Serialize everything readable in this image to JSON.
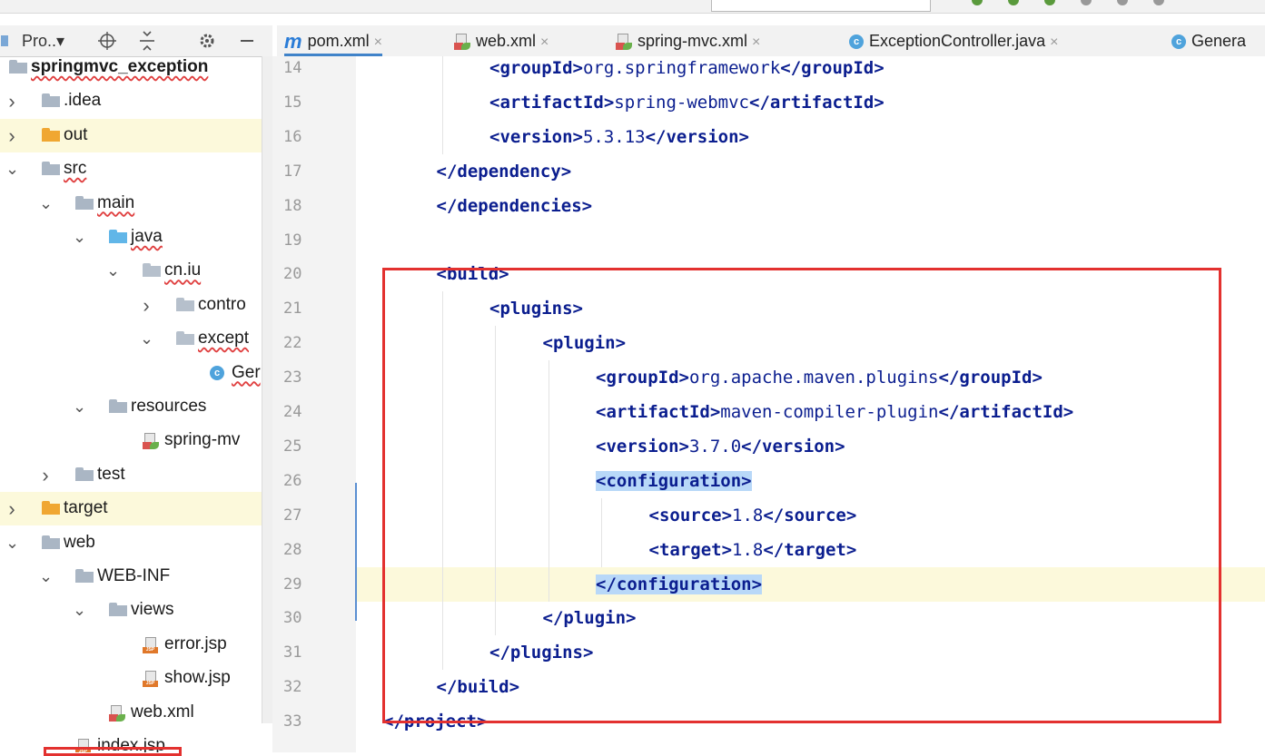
{
  "project_header": {
    "label": "Pro..▾",
    "icons": [
      "target-icon",
      "collapse-icon",
      "gear-icon",
      "minimize-icon"
    ]
  },
  "tabs": [
    {
      "label": "pom.xml",
      "icon": "maven-icon",
      "close": "×",
      "active": true
    },
    {
      "label": "web.xml",
      "icon": "xml-file-icon",
      "close": "×"
    },
    {
      "label": "spring-mvc.xml",
      "icon": "xml-file-icon",
      "close": "×"
    },
    {
      "label": "ExceptionController.java",
      "icon": "class-icon",
      "close": "×"
    },
    {
      "label": "Genera",
      "icon": "class-icon",
      "close": ""
    }
  ],
  "tree": [
    {
      "label": "springmvc_exception",
      "icon": "folder",
      "depth": 0,
      "arrow": "",
      "bold": true,
      "wavy": true
    },
    {
      "label": ".idea",
      "icon": "folder-grey",
      "depth": 0,
      "arrow": ">"
    },
    {
      "label": "out",
      "icon": "folder-orange",
      "depth": 0,
      "arrow": ">",
      "highlight": true
    },
    {
      "label": "src",
      "icon": "folder-grey",
      "depth": 0,
      "arrow": "v",
      "wavy": true
    },
    {
      "label": "main",
      "icon": "folder-grey",
      "depth": 1,
      "arrow": "v",
      "wavy": true
    },
    {
      "label": "java",
      "icon": "folder-blue",
      "depth": 2,
      "arrow": "v",
      "wavy": true
    },
    {
      "label": "cn.iu",
      "icon": "package",
      "depth": 3,
      "arrow": "v",
      "wavy": true
    },
    {
      "label": "contro",
      "icon": "package",
      "depth": 4,
      "arrow": ">"
    },
    {
      "label": "except",
      "icon": "package",
      "depth": 4,
      "arrow": "v",
      "wavy": true
    },
    {
      "label": "Ger",
      "icon": "class",
      "depth": 5,
      "arrow": "",
      "wavy": true
    },
    {
      "label": "resources",
      "icon": "folder-res",
      "depth": 2,
      "arrow": "v"
    },
    {
      "label": "spring-mv",
      "icon": "xml",
      "depth": 3,
      "arrow": ""
    },
    {
      "label": "test",
      "icon": "folder-grey",
      "depth": 1,
      "arrow": ">"
    },
    {
      "label": "target",
      "icon": "folder-orange",
      "depth": 0,
      "arrow": ">",
      "highlight": true
    },
    {
      "label": "web",
      "icon": "folder-web",
      "depth": 0,
      "arrow": "v"
    },
    {
      "label": "WEB-INF",
      "icon": "folder-grey",
      "depth": 1,
      "arrow": "v"
    },
    {
      "label": "views",
      "icon": "folder-grey",
      "depth": 2,
      "arrow": "v"
    },
    {
      "label": "error.jsp",
      "icon": "jsp",
      "depth": 3,
      "arrow": ""
    },
    {
      "label": "show.jsp",
      "icon": "jsp",
      "depth": 3,
      "arrow": ""
    },
    {
      "label": "web.xml",
      "icon": "xml",
      "depth": 2,
      "arrow": ""
    },
    {
      "label": "index.jsp",
      "icon": "jsp",
      "depth": 1,
      "arrow": "",
      "wavy": true
    }
  ],
  "code_lines": [
    {
      "n": "14",
      "indent": 2,
      "parts": [
        [
          "tg",
          "<groupId>"
        ],
        [
          "pt",
          "org.springframework"
        ],
        [
          "tg",
          "</groupId>"
        ]
      ]
    },
    {
      "n": "15",
      "indent": 2,
      "parts": [
        [
          "tg",
          "<artifactId>"
        ],
        [
          "pt",
          "spring-webmvc"
        ],
        [
          "tg",
          "</artifactId>"
        ]
      ]
    },
    {
      "n": "16",
      "indent": 2,
      "parts": [
        [
          "tg",
          "<version>"
        ],
        [
          "pt",
          "5.3.13"
        ],
        [
          "tg",
          "</version>"
        ]
      ]
    },
    {
      "n": "17",
      "indent": 1,
      "parts": [
        [
          "tg",
          "</dependency>"
        ]
      ],
      "fold": true
    },
    {
      "n": "18",
      "indent": 1,
      "parts": [
        [
          "tg",
          "</dependencies>"
        ]
      ],
      "fold": true
    },
    {
      "n": "19",
      "indent": 0,
      "parts": []
    },
    {
      "n": "20",
      "indent": 1,
      "parts": [
        [
          "tg",
          "<build>"
        ]
      ],
      "fold": true
    },
    {
      "n": "21",
      "indent": 2,
      "parts": [
        [
          "tg",
          "<plugins>"
        ]
      ],
      "fold": true
    },
    {
      "n": "22",
      "indent": 3,
      "parts": [
        [
          "tg",
          "<plugin>"
        ]
      ],
      "fold": true
    },
    {
      "n": "23",
      "indent": 4,
      "parts": [
        [
          "tg",
          "<groupId>"
        ],
        [
          "pt",
          "org.apache.maven.plugins"
        ],
        [
          "tg",
          "</groupId>"
        ]
      ]
    },
    {
      "n": "24",
      "indent": 4,
      "parts": [
        [
          "tg",
          "<artifactId>"
        ],
        [
          "pt",
          "maven-compiler-plugin"
        ],
        [
          "tg",
          "</artifactId>"
        ]
      ]
    },
    {
      "n": "25",
      "indent": 4,
      "parts": [
        [
          "tg",
          "<version>"
        ],
        [
          "pt",
          "3.7.0"
        ],
        [
          "tg",
          "</version>"
        ]
      ]
    },
    {
      "n": "26",
      "indent": 4,
      "parts": [
        [
          "tgh",
          "<configuration>"
        ]
      ],
      "fold": true
    },
    {
      "n": "27",
      "indent": 5,
      "parts": [
        [
          "tg",
          "<source>"
        ],
        [
          "pt",
          "1.8"
        ],
        [
          "tg",
          "</source>"
        ]
      ]
    },
    {
      "n": "28",
      "indent": 5,
      "parts": [
        [
          "tg",
          "<target>"
        ],
        [
          "pt",
          "1.8"
        ],
        [
          "tg",
          "</target>"
        ]
      ]
    },
    {
      "n": "29",
      "indent": 4,
      "parts": [
        [
          "tgh",
          "</configuration>"
        ]
      ],
      "fold": true,
      "current": true
    },
    {
      "n": "30",
      "indent": 3,
      "parts": [
        [
          "tg",
          "</plugin>"
        ]
      ],
      "fold": true
    },
    {
      "n": "31",
      "indent": 2,
      "parts": [
        [
          "tg",
          "</plugins>"
        ]
      ],
      "fold": true
    },
    {
      "n": "32",
      "indent": 1,
      "parts": [
        [
          "tg",
          "</build>"
        ]
      ],
      "fold": true
    },
    {
      "n": "33",
      "indent": 0,
      "parts": [
        [
          "tg",
          "</project>"
        ]
      ],
      "fold": true
    }
  ],
  "colors": {
    "accent": "#4083c9",
    "highlight_box": "#e3312f",
    "tag": "#0b1e8f"
  }
}
